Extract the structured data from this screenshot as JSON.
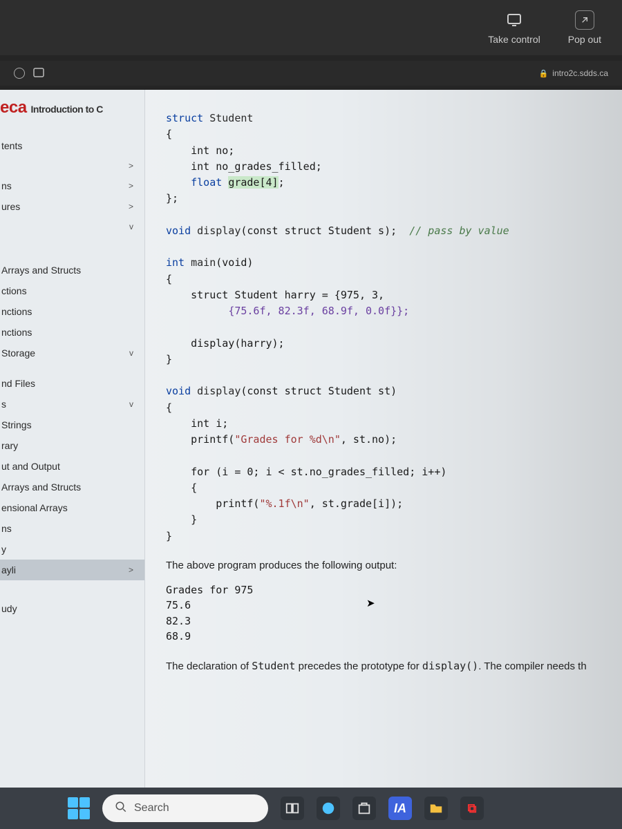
{
  "vm_toolbar": {
    "take_control": "Take control",
    "pop_out": "Pop out"
  },
  "browser": {
    "url": "intro2c.sdds.ca"
  },
  "brand": {
    "logo_fragment": "eca",
    "subtitle": "Introduction to C"
  },
  "sidebar": {
    "items": [
      {
        "label": "tents",
        "chevron": ""
      },
      {
        "label": "",
        "chevron": ">"
      },
      {
        "label": "ns",
        "chevron": ">"
      },
      {
        "label": "ures",
        "chevron": ">"
      },
      {
        "label": "",
        "chevron": "v"
      },
      {
        "label": "Arrays and Structs",
        "chevron": ""
      },
      {
        "label": "ctions",
        "chevron": ""
      },
      {
        "label": "nctions",
        "chevron": ""
      },
      {
        "label": "nctions",
        "chevron": ""
      },
      {
        "label": "Storage",
        "chevron": "v"
      },
      {
        "label": "",
        "chevron": ""
      },
      {
        "label": "nd Files",
        "chevron": ""
      },
      {
        "label": "s",
        "chevron": "v"
      },
      {
        "label": "Strings",
        "chevron": ""
      },
      {
        "label": "rary",
        "chevron": ""
      },
      {
        "label": "ut and Output",
        "chevron": ""
      },
      {
        "label": "Arrays and Structs",
        "chevron": ""
      },
      {
        "label": "ensional Arrays",
        "chevron": ""
      },
      {
        "label": "ns",
        "chevron": ""
      },
      {
        "label": "y",
        "chevron": ""
      },
      {
        "label": "ayli",
        "chevron": ">"
      },
      {
        "label": "",
        "chevron": ""
      },
      {
        "label": "udy",
        "chevron": ""
      }
    ]
  },
  "content": {
    "body_text_1": "The above program produces the following output:",
    "body_text_2": "The declaration of Student precedes the prototype for display(). The compiler needs th",
    "output_lines": [
      "Grades for 975",
      "75.6",
      "82.3",
      "68.9"
    ],
    "code": {
      "struct_kw": "struct",
      "student_id": "Student",
      "lbrace": "{",
      "int_no": "int no;",
      "int_nogrades": "int no_grades_filled;",
      "float_kw": "float",
      "grade_tok": "grade[4]",
      "semibrace": "};",
      "void_kw": "void",
      "display_id": "display",
      "proto_args": "(const struct Student s);",
      "comment_pass": "// pass by value",
      "int_kw": "int",
      "main_id": "main",
      "main_args": "(void)",
      "harry_decl": "struct Student harry = {975, 3,",
      "harry_vals": "{75.6f, 82.3f, 68.9f, 0.0f}};",
      "display_call": "display(harry);",
      "rbrace": "}",
      "def_args": "(const struct Student st)",
      "int_i": "int i;",
      "printf1a": "printf(",
      "printf1s": "\"Grades for %d\\n\"",
      "printf1b": ", st.no);",
      "for_line": "for (i = 0; i < st.no_grades_filled; i++)",
      "printf2a": "printf(",
      "printf2s": "\"%.1f\\n\"",
      "printf2b": ", st.grade[i]);"
    }
  },
  "taskbar": {
    "search_placeholder": "Search"
  }
}
